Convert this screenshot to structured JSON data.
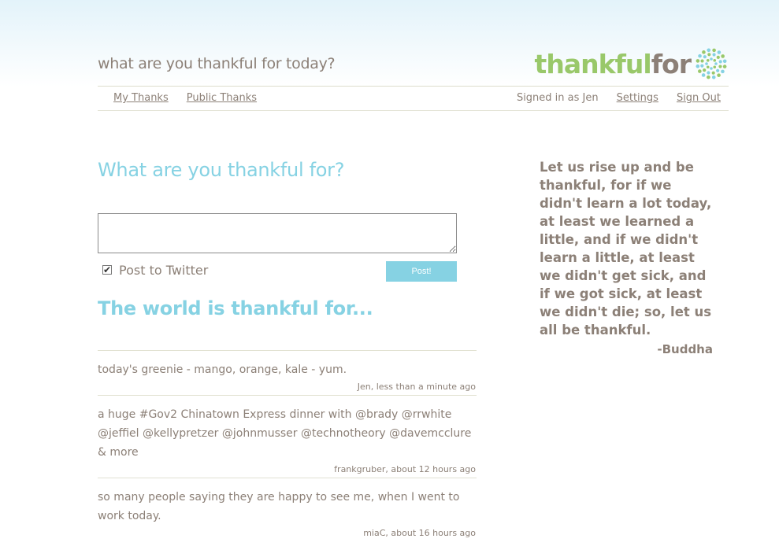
{
  "header": {
    "tagline": "what are you thankful for today?",
    "logo_part1": "thankful",
    "logo_part2": "for"
  },
  "nav": {
    "my_thanks": "My Thanks",
    "public_thanks": "Public Thanks",
    "signed_in": "Signed in as Jen",
    "settings": "Settings",
    "sign_out": "Sign Out"
  },
  "form": {
    "heading": "What are you thankful for?",
    "input_value": "",
    "post_to_twitter_label": "Post to Twitter",
    "post_to_twitter_checked": true,
    "post_button": "Post!"
  },
  "feed": {
    "heading": "The world is thankful for...",
    "items": [
      {
        "text": "today's greenie - mango, orange, kale - yum.",
        "meta": "Jen, less than a minute ago"
      },
      {
        "text": "a huge #Gov2 Chinatown Express dinner with @brady @rrwhite @jeffiel @kellypretzer @johnmusser @technotheory @davemcclure & more",
        "meta": "frankgruber, about 12 hours ago"
      },
      {
        "text": "so many people saying they are happy to see me, when I went to work today.",
        "meta": "miaC, about 16 hours ago"
      }
    ]
  },
  "quote": {
    "text": "Let us rise up and be thankful, for if we didn't learn a lot today, at least we learned a little, and if we didn't learn a little, at least we didn't get sick, and if we got sick, at least we didn't die; so, let us all be thankful.",
    "author": "-Buddha"
  },
  "colors": {
    "accent_blue": "#86d2e3",
    "brand_green": "#99c86a",
    "text_taupe": "#8c8077"
  }
}
